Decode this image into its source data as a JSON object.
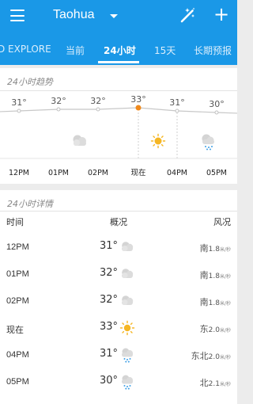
{
  "header": {
    "city": "Taohua",
    "icons": {
      "menu": "menu-icon",
      "city_dropdown": "caret-down-icon",
      "theme": "magic-wand-icon",
      "add": "plus-icon"
    }
  },
  "tabs": [
    "D EXPLORE",
    "当前",
    "24小时",
    "15天",
    "长期预报"
  ],
  "active_tab": "24小时",
  "trend": {
    "title": "24小时趋势",
    "times": [
      "12PM",
      "01PM",
      "02PM",
      "现在",
      "04PM",
      "05PM"
    ],
    "temps": [
      "31°",
      "32°",
      "32°",
      "33°",
      "31°",
      "30°"
    ],
    "temp_values": [
      31,
      32,
      32,
      33,
      31,
      30
    ],
    "icons": [
      "cloudy-icon",
      "sunny-icon",
      "rain-icon"
    ],
    "colors": {
      "current": "#f08a1c",
      "line": "#c8c8c8"
    }
  },
  "detail": {
    "title": "24小时详情",
    "headers": {
      "time": "时间",
      "condition": "概况",
      "wind": "风况"
    },
    "rows": [
      {
        "time": "12PM",
        "temp": "31°",
        "icon": "cloudy-icon",
        "wind": "南",
        "wind_level": "1.8",
        "wind_unit": "米/秒"
      },
      {
        "time": "01PM",
        "temp": "32°",
        "icon": "cloudy-icon",
        "wind": "南",
        "wind_level": "1.8",
        "wind_unit": "米/秒"
      },
      {
        "time": "02PM",
        "temp": "32°",
        "icon": "cloudy-icon",
        "wind": "南",
        "wind_level": "1.8",
        "wind_unit": "米/秒"
      },
      {
        "time": "现在",
        "temp": "33°",
        "icon": "sunny-icon",
        "wind": "东",
        "wind_level": "2.0",
        "wind_unit": "米/秒"
      },
      {
        "time": "04PM",
        "temp": "31°",
        "icon": "rain-icon",
        "wind": "东北",
        "wind_level": "2.0",
        "wind_unit": "米/秒"
      },
      {
        "time": "05PM",
        "temp": "30°",
        "icon": "rain-icon",
        "wind": "北",
        "wind_level": "2.1",
        "wind_unit": "米/秒"
      }
    ]
  }
}
